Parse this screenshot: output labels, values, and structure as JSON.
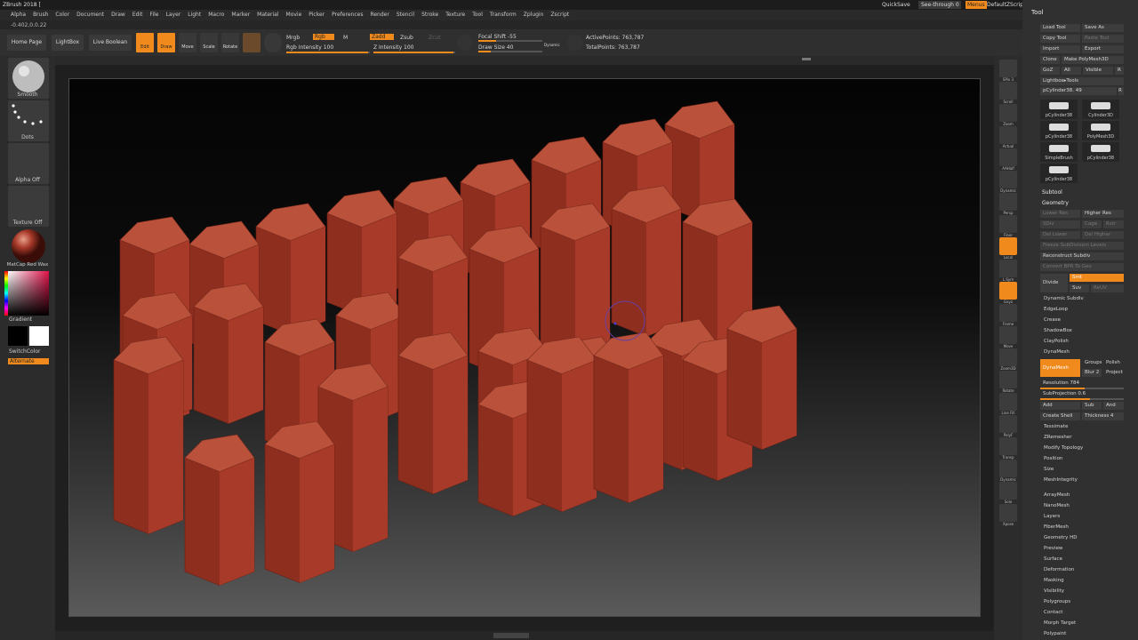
{
  "titlebar": {
    "title": "ZBrush 2018 [",
    "quicksave": "QuickSave",
    "seethrough": "See-through   0",
    "menus": "Menus",
    "defaultscript": "DefaultZScript"
  },
  "menu": [
    "Alpha",
    "Brush",
    "Color",
    "Document",
    "Draw",
    "Edit",
    "File",
    "Layer",
    "Light",
    "Macro",
    "Marker",
    "Material",
    "Movie",
    "Picker",
    "Preferences",
    "Render",
    "Stencil",
    "Stroke",
    "Texture",
    "Tool",
    "Transform",
    "Zplugin",
    "Zscript"
  ],
  "coords": "-0.402,0.0.22",
  "shelf": {
    "home": "Home Page",
    "lightbox": "LightBox",
    "liveboolean": "Live Boolean",
    "edit": "Edit",
    "draw": "Draw",
    "move": "Move",
    "scale": "Scale",
    "rotate": "Rotate",
    "mrgb": "Mrgb",
    "rgb": "Rgb",
    "m": "M",
    "zadd": "Zadd",
    "zsub": "Zsub",
    "zcut": "Zcut",
    "rgb_intensity": "Rgb Intensity 100",
    "z_intensity": "Z Intensity 100",
    "focal_shift": "Focal Shift -55",
    "draw_size": "Draw Size 40",
    "dynamic": "Dynamic",
    "active_points": "ActivePoints: 763,787",
    "total_points": "TotalPoints: 763,787"
  },
  "left": {
    "smooth": "Smooth",
    "dots": "Dots",
    "alpha": "Alpha Off",
    "texture": "Texture Off",
    "material": "MatCap Red Wax",
    "gradient": "Gradient",
    "switchcolor": "SwitchColor",
    "alternate": "Alternate"
  },
  "right": [
    "SPix 3",
    "Scroll",
    "Zoom",
    "Actual",
    "AAHalf",
    "Dynamic",
    "Persp",
    "Floor",
    "Local",
    "L.Sym",
    "Gxyz",
    "Frame",
    "Move",
    "Zoom3D",
    "Rotate",
    "Line Fill",
    "PolyF",
    "Transp",
    "Dynamic",
    "Solo",
    "Xpose"
  ],
  "tool": {
    "title": "Tool",
    "load": "Load Tool",
    "saveas": "Save As",
    "copy": "Copy Tool",
    "paste": "Paste Tool",
    "import": "Import",
    "export": "Export",
    "clone": "Clone",
    "makepoly": "Make PolyMesh3D",
    "goz": "GoZ",
    "all": "All",
    "visible": "Visible",
    "r": "R",
    "lightbox": "Lightbox▸Tools",
    "current": "pCylinder38. 49",
    "thumbs": [
      "pCylinder38",
      "Cylinder3D",
      "pCylinder38",
      "PolyMesh3D",
      "SimpleBrush",
      "pCylinder38",
      "pCylinder38"
    ],
    "subtool": "Subtool",
    "geometry": "Geometry",
    "lowerres": "Lower Res",
    "higherres": "Higher Res",
    "sdiv": "SDiv",
    "cage": "Cage",
    "rstr": "Rstr",
    "dellower": "Del Lower",
    "delhigher": "Del Higher",
    "freeze": "Freeze SubDivision Levels",
    "reconstruct": "Reconstruct Subdiv",
    "convertbpr": "Convert BPR To Geo",
    "divide": "Divide",
    "smt": "Smt",
    "suv": "Suv",
    "reuv": "ReUV",
    "dynsubdiv": "Dynamic Subdiv",
    "edgeloop": "EdgeLoop",
    "crease": "Crease",
    "shadowbox": "ShadowBox",
    "claypolish": "ClayPolish",
    "dynamesh_h": "DynaMesh",
    "dynamesh": "DynaMesh",
    "groups": "Groups",
    "polish": "Polish",
    "blur": "Blur 2",
    "project": "Project",
    "resolution": "Resolution 784",
    "subprojection": "SubProjection 0.6",
    "add": "Add",
    "sub": "Sub",
    "and": "And",
    "createshell": "Create Shell",
    "thickness": "Thickness 4",
    "tessimate": "Tessimate",
    "zremesher": "ZRemesher",
    "modtopo": "Modify Topology",
    "position": "Position",
    "size": "Size",
    "meshintegrity": "MeshIntegrity",
    "sections": [
      "ArrayMesh",
      "NanoMesh",
      "Layers",
      "FiberMesh",
      "Geometry HD",
      "Preview",
      "Surface",
      "Deformation",
      "Masking",
      "Visibility",
      "Polygroups",
      "Contact",
      "Morph Target",
      "Polypaint"
    ]
  },
  "colors": {
    "accent": "#f08a1c",
    "mesh": "#a33a29",
    "panel": "#303030"
  }
}
